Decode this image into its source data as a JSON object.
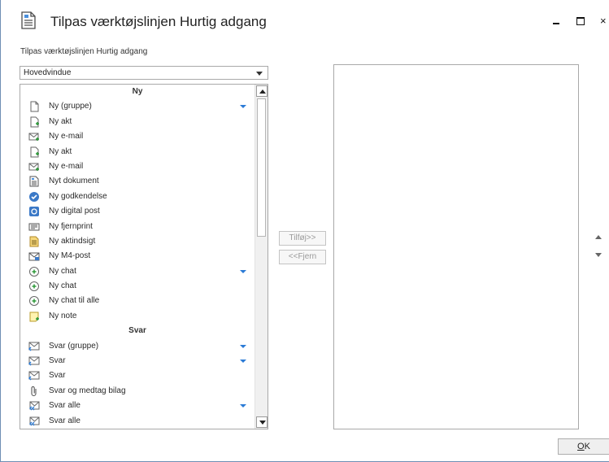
{
  "window": {
    "title": "Tilpas værktøjslinjen Hurtig adgang",
    "close_glyph": "×"
  },
  "section_label": "Tilpas værktøjslinjen Hurtig adgang",
  "dropdown": {
    "selected": "Hovedvindue"
  },
  "list": {
    "rows": [
      {
        "type": "header",
        "label": "Ny"
      },
      {
        "type": "item",
        "label": "Ny (gruppe)",
        "icon": "blank-document-icon",
        "dropdown": true
      },
      {
        "type": "item",
        "label": "Ny akt",
        "icon": "new-document-icon",
        "dropdown": false
      },
      {
        "type": "item",
        "label": "Ny e-mail",
        "icon": "new-mail-icon",
        "dropdown": false
      },
      {
        "type": "item",
        "label": "Ny akt",
        "icon": "new-document-icon",
        "dropdown": false
      },
      {
        "type": "item",
        "label": "Ny e-mail",
        "icon": "new-mail-icon",
        "dropdown": false
      },
      {
        "type": "item",
        "label": "Nyt dokument",
        "icon": "text-document-icon",
        "dropdown": false
      },
      {
        "type": "item",
        "label": "Ny godkendelse",
        "icon": "approval-icon",
        "dropdown": false
      },
      {
        "type": "item",
        "label": "Ny digital post",
        "icon": "digital-post-icon",
        "dropdown": false
      },
      {
        "type": "item",
        "label": "Ny fjernprint",
        "icon": "remote-print-icon",
        "dropdown": false
      },
      {
        "type": "item",
        "label": "Ny aktindsigt",
        "icon": "access-document-icon",
        "dropdown": false
      },
      {
        "type": "item",
        "label": "Ny M4-post",
        "icon": "m4-mail-icon",
        "dropdown": false
      },
      {
        "type": "item",
        "label": "Ny chat",
        "icon": "chat-add-icon",
        "dropdown": true
      },
      {
        "type": "item",
        "label": "Ny chat",
        "icon": "chat-add-icon",
        "dropdown": false
      },
      {
        "type": "item",
        "label": "Ny chat til alle",
        "icon": "chat-add-icon",
        "dropdown": false
      },
      {
        "type": "item",
        "label": "Ny note",
        "icon": "new-note-icon",
        "dropdown": false
      },
      {
        "type": "header",
        "label": "Svar"
      },
      {
        "type": "item",
        "label": "Svar (gruppe)",
        "icon": "reply-icon",
        "dropdown": true
      },
      {
        "type": "item",
        "label": "Svar",
        "icon": "reply-icon",
        "dropdown": true
      },
      {
        "type": "item",
        "label": "Svar",
        "icon": "reply-icon",
        "dropdown": false
      },
      {
        "type": "item",
        "label": "Svar og medtag bilag",
        "icon": "paperclip-icon",
        "dropdown": false
      },
      {
        "type": "item",
        "label": "Svar alle",
        "icon": "reply-all-icon",
        "dropdown": true
      },
      {
        "type": "item",
        "label": "Svar alle",
        "icon": "reply-all-icon",
        "dropdown": false
      }
    ]
  },
  "buttons": {
    "add": "Tilføj>>",
    "remove": "<<Fjern",
    "ok_first": "O",
    "ok_rest": "K"
  },
  "colors": {
    "accent": "#2b7bd6",
    "border": "#a9a9a9"
  }
}
